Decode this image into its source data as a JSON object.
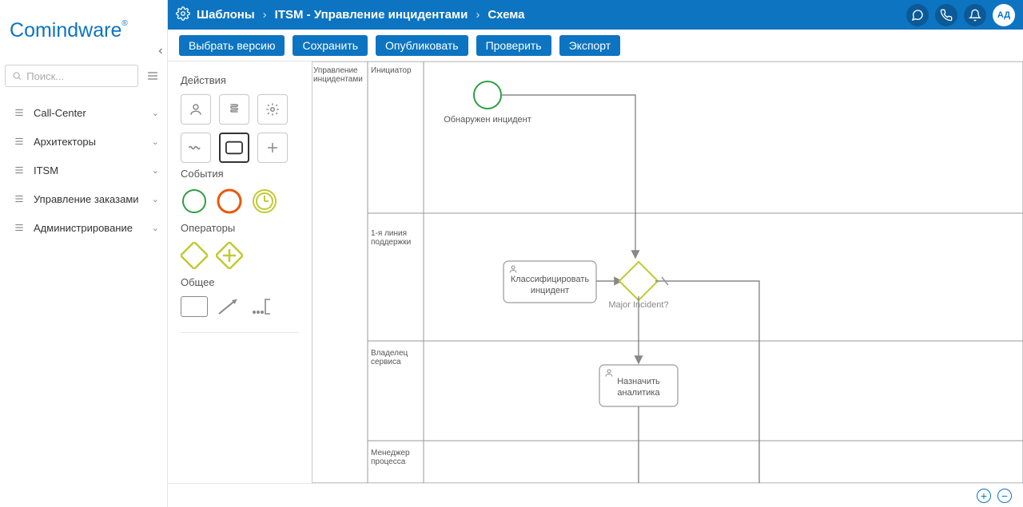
{
  "header": {
    "breadcrumbs": [
      "Шаблоны",
      "ITSM - Управление инцидентами",
      "Схема"
    ],
    "avatar_initials": "АД"
  },
  "actions": {
    "choose_version": "Выбрать версию",
    "save": "Сохранить",
    "publish": "Опубликовать",
    "check": "Проверить",
    "export": "Экспорт"
  },
  "search": {
    "placeholder": "Поиск..."
  },
  "sidebar": {
    "items": [
      {
        "label": "Call-Center"
      },
      {
        "label": "Архитекторы"
      },
      {
        "label": "ITSM"
      },
      {
        "label": "Управление заказами"
      },
      {
        "label": "Администрирование"
      }
    ]
  },
  "palette": {
    "sections": [
      {
        "title": "Действия"
      },
      {
        "title": "События"
      },
      {
        "title": "Операторы"
      },
      {
        "title": "Общее"
      }
    ]
  },
  "diagram": {
    "pool_title": "Управление инцидентами",
    "lanes": [
      {
        "title": "Инициатор"
      },
      {
        "title": "1-я линия поддержки"
      },
      {
        "title": "Владелец сервиса"
      },
      {
        "title": "Менеджер процесса"
      }
    ],
    "nodes": {
      "start": {
        "label": "Обнаружен инцидент"
      },
      "classify": {
        "label_l1": "Классифицировать",
        "label_l2": "инцидент"
      },
      "gateway": {
        "label": "Major Incident?"
      },
      "assign": {
        "label_l1": "Назначить",
        "label_l2": "аналитика"
      }
    }
  }
}
